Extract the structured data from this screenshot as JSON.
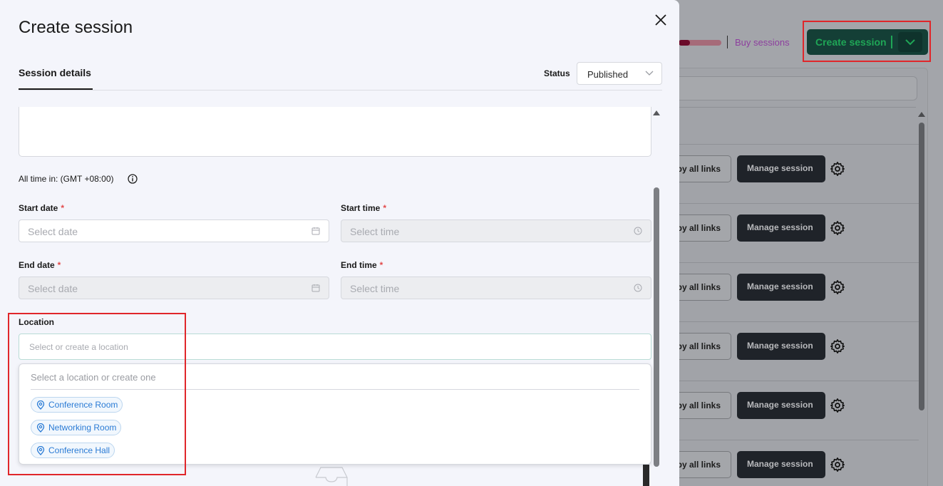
{
  "background": {
    "buy_sessions": "Buy sessions",
    "create_session_button": "Create session",
    "rows": [
      {
        "copy_label": "py all links",
        "manage_label": "Manage session"
      },
      {
        "copy_label": "py all links",
        "manage_label": "Manage session"
      },
      {
        "copy_label": "py all links",
        "manage_label": "Manage session"
      },
      {
        "copy_label": "py all links",
        "manage_label": "Manage session"
      },
      {
        "copy_label": "py all links",
        "manage_label": "Manage session"
      },
      {
        "copy_label": "py all links",
        "manage_label": "Manage session"
      }
    ]
  },
  "modal": {
    "title": "Create session",
    "close_icon": "close-icon",
    "tab": "Session details",
    "status_label": "Status",
    "status_value": "Published",
    "timezone": "All time in: (GMT +08:00)",
    "start_date": {
      "label": "Start date",
      "required": "*",
      "placeholder": "Select date"
    },
    "start_time": {
      "label": "Start time",
      "required": "*",
      "placeholder": "Select time"
    },
    "end_date": {
      "label": "End date",
      "required": "*",
      "placeholder": "Select date"
    },
    "end_time": {
      "label": "End time",
      "required": "*",
      "placeholder": "Select time"
    },
    "location": {
      "label": "Location",
      "placeholder": "Select or create a location",
      "dropdown_hint": "Select a location or create one",
      "options": [
        "Conference Room",
        "Networking Room",
        "Conference Hall"
      ]
    }
  },
  "colors": {
    "accent_green": "#1fa656",
    "chip_blue": "#2a7bd5",
    "required_red": "#e24a4a",
    "highlight_red": "#e0262a"
  }
}
